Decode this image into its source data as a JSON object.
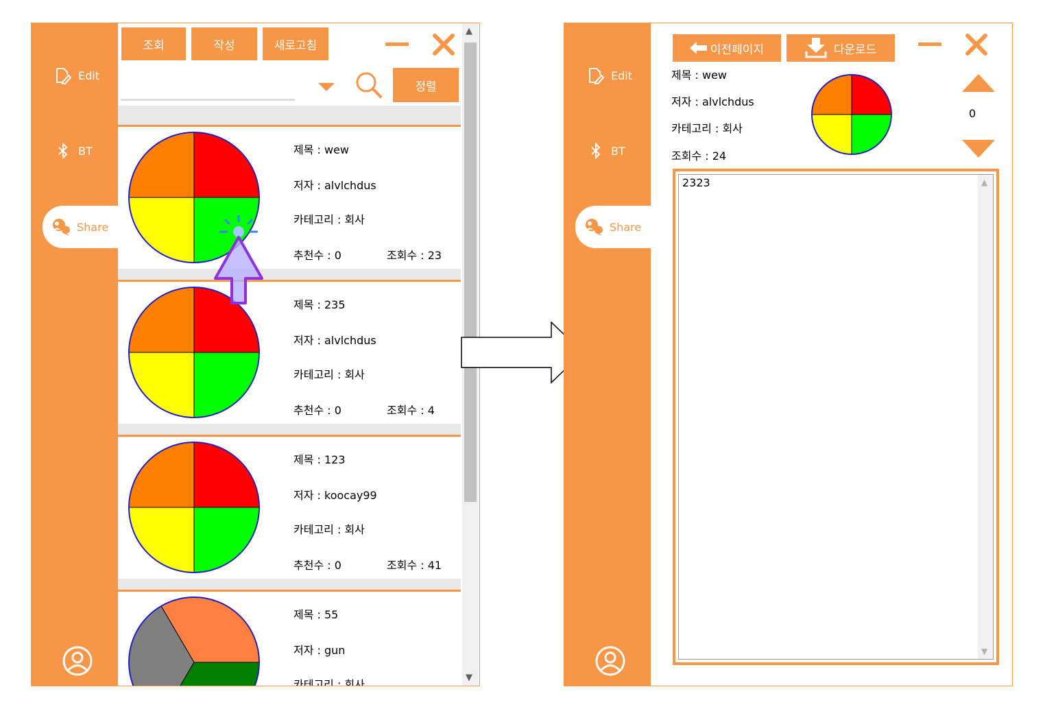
{
  "sidebar": {
    "items": [
      {
        "label": "Edit",
        "icon": "edit-icon"
      },
      {
        "label": "BT",
        "icon": "bluetooth-icon"
      },
      {
        "label": "Share",
        "icon": "share-chat-icon"
      }
    ],
    "profile_icon": "user-profile-icon"
  },
  "list_view": {
    "toolbar": {
      "view_label": "조회",
      "write_label": "작성",
      "refresh_label": "새로고침",
      "sort_label": "정렬"
    },
    "search": {
      "dropdown_icon": "dropdown-arrow-icon",
      "search_icon": "search-icon"
    },
    "cards": [
      {
        "title": "제목 : wew",
        "author": "저자 : alvlchdus",
        "category": "카테고리 : 회사",
        "likes": "추천수 : 0",
        "views": "조회수 : 23",
        "pie_type": "quad"
      },
      {
        "title": "제목 : 235",
        "author": "저자 : alvlchdus",
        "category": "카테고리 : 회사",
        "likes": "추천수 : 0",
        "views": "조회수 : 4",
        "pie_type": "quad"
      },
      {
        "title": "제목 : 123",
        "author": "저자 : koocay99",
        "category": "카테고리 : 회사",
        "likes": "추천수 : 0",
        "views": "조회수 : 41",
        "pie_type": "quad"
      },
      {
        "title": "제목 : 55",
        "author": "저자 : gun",
        "category": "카테고리 : 회사",
        "likes": "",
        "views": "",
        "pie_type": "tri"
      }
    ]
  },
  "detail_view": {
    "toolbar": {
      "back_label": "이전페이지",
      "download_label": "다운로드"
    },
    "title": "제목 : wew",
    "author": "저자 : alvlchdus",
    "category": "카테고리 : 회사",
    "views": "조회수 : 24",
    "vote_count": "0",
    "content": "2323"
  },
  "colors": {
    "accent": "#f79646",
    "pie_orange": "#ff8000",
    "pie_red": "#ff0000",
    "pie_yellow": "#ffff00",
    "pie_green": "#00ff00",
    "pie_coral": "#ff8040",
    "pie_gray": "#808080",
    "pie_darkgreen": "#008000"
  }
}
